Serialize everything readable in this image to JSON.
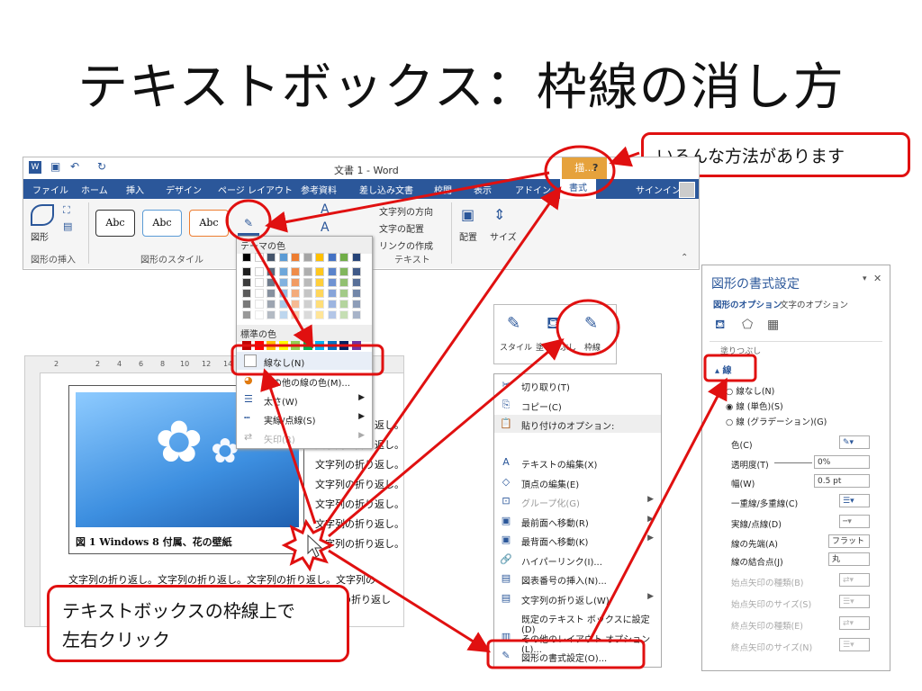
{
  "slide": {
    "title": "テキストボックス：枠線の消し方",
    "callout_top": "いろんな方法があります",
    "callout_bottom_line1": "テキストボックスの枠線上で",
    "callout_bottom_line2": "左右クリック"
  },
  "word_window": {
    "title": "文書 1 - Word",
    "context_tab": "描...",
    "help": "?",
    "tabs": [
      "ファイル",
      "ホーム",
      "挿入",
      "デザイン",
      "ページ レイアウト",
      "参考資料",
      "差し込み文書",
      "校閲",
      "表示",
      "アドイン",
      "書式"
    ],
    "signin": "サインイン",
    "insert_shapes_label": "図形",
    "group_insert_shapes": "図形の挿入",
    "group_shape_styles": "図形のスタイル",
    "group_text": "テキスト",
    "style_sample": "Abc",
    "text_direction": "文字列の方向",
    "text_align": "文字の配置",
    "create_link": "リンクの作成",
    "arrange": "配置",
    "size": "サイズ"
  },
  "outline_menu": {
    "theme_colors": "テーマの色",
    "standard_colors": "標準の色",
    "no_outline": "線なし(N)",
    "more_colors": "その他の線の色(M)...",
    "weight": "太さ(W)",
    "dashes": "実線/点線(S)",
    "arrows": "矢印(R)",
    "theme_palette": [
      "#000000",
      "#ffffff",
      "#44546a",
      "#5b9bd5",
      "#ed7d31",
      "#a5a5a5",
      "#ffc000",
      "#4472c4",
      "#70ad47",
      "#264478"
    ],
    "standard_palette": [
      "#c00000",
      "#ff0000",
      "#ffc000",
      "#ffff00",
      "#92d050",
      "#00b050",
      "#00b0f0",
      "#0070c0",
      "#002060",
      "#7030a0"
    ]
  },
  "document": {
    "ruler_numbers": [
      "2",
      "2",
      "4",
      "6",
      "8",
      "10",
      "12",
      "14"
    ],
    "caption": "図 1 Windows 8 付属、花の壁紙",
    "wrap_line": "文字列の折り返し。",
    "bottom_line": "文字列の折り返し。文字列の折り返し。文字列の折り返し。文字列の",
    "bottom_line2": "列の折り返し"
  },
  "mini_toolbar": {
    "style": "スタイル",
    "fill": "塗りつぶし",
    "outline": "枠線"
  },
  "context_menu": {
    "items": [
      {
        "label": "切り取り(T)",
        "icon": "✂",
        "disabled": false,
        "sub": false
      },
      {
        "label": "コピー(C)",
        "icon": "⎘",
        "disabled": false,
        "sub": false
      },
      {
        "label": "貼り付けのオプション:",
        "icon": "📋",
        "disabled": false,
        "sub": false
      },
      {
        "label": "",
        "icon": "",
        "disabled": false,
        "sub": false
      },
      {
        "label": "テキストの編集(X)",
        "icon": "A",
        "disabled": false,
        "sub": false
      },
      {
        "label": "頂点の編集(E)",
        "icon": "◇",
        "disabled": false,
        "sub": false
      },
      {
        "label": "グループ化(G)",
        "icon": "⊡",
        "disabled": true,
        "sub": true
      },
      {
        "label": "最前面へ移動(R)",
        "icon": "▣",
        "disabled": false,
        "sub": true
      },
      {
        "label": "最背面へ移動(K)",
        "icon": "▣",
        "disabled": false,
        "sub": true
      },
      {
        "label": "ハイパーリンク(I)...",
        "icon": "🔗",
        "disabled": false,
        "sub": false
      },
      {
        "label": "図表番号の挿入(N)...",
        "icon": "▤",
        "disabled": false,
        "sub": false
      },
      {
        "label": "文字列の折り返し(W)",
        "icon": "▤",
        "disabled": false,
        "sub": true
      },
      {
        "label": "既定のテキスト ボックスに設定(D)",
        "icon": "",
        "disabled": false,
        "sub": false
      },
      {
        "label": "その他のレイアウト オプション(L)...",
        "icon": "▥",
        "disabled": false,
        "sub": false
      },
      {
        "label": "図形の書式設定(O)...",
        "icon": "✎",
        "disabled": false,
        "sub": false
      }
    ]
  },
  "format_pane": {
    "title": "図形の書式設定",
    "tab_shape": "図形のオプション",
    "tab_text": "文字のオプション",
    "fill_section": "塗りつぶし",
    "line_section": "線",
    "opt_none": "線なし(N)",
    "opt_solid": "線 (単色)(S)",
    "opt_gradient": "線 (グラデーション)(G)",
    "color": "色(C)",
    "transparency": "透明度(T)",
    "transparency_value": "0%",
    "width": "幅(W)",
    "width_value": "0.5 pt",
    "compound": "一重線/多重線(C)",
    "dash": "実線/点線(D)",
    "cap": "線の先端(A)",
    "cap_value": "フラット",
    "join": "線の結合点(J)",
    "join_value": "丸",
    "begin_type": "始点矢印の種類(B)",
    "begin_size": "始点矢印のサイズ(S)",
    "end_type": "終点矢印の種類(E)",
    "end_size": "終点矢印のサイズ(N)"
  }
}
